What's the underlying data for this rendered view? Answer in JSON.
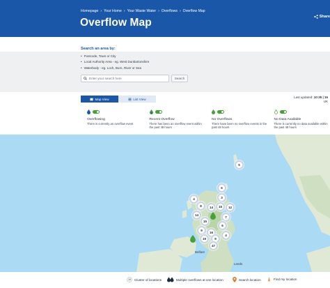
{
  "breadcrumbs": [
    "Homepage",
    "Your Home",
    "Your Waste Water",
    "Overflows",
    "Overflow Map"
  ],
  "page_title": "Overflow Map",
  "share_label": "Share",
  "search": {
    "heading": "Search an area by:",
    "hints": [
      "Postcode, Town or City",
      "Local Authority Area - eg. West Dunbartonshire",
      "Waterbody - eg. Loch, Burn, River or Sea"
    ],
    "placeholder": "Enter your search here",
    "button_label": "Search"
  },
  "tabs": [
    {
      "label": "Map View",
      "active": true,
      "icon": "map-icon"
    },
    {
      "label": "List View",
      "active": false,
      "icon": "list-icon"
    }
  ],
  "last_updated": {
    "label": "Last updated:",
    "value": "10:35 | 16",
    "suffix": "UK"
  },
  "legend": [
    {
      "title": "Overflowing",
      "desc": "There is currently an overflow event",
      "color": "#1a57a8",
      "icon": "droplet-icon"
    },
    {
      "title": "Recent Overflow",
      "desc": "There has been an overflow event within the past 48 hours",
      "color": "#48a03a",
      "icon": "droplet-icon"
    },
    {
      "title": "No Overflows",
      "desc": "There have been no overflow events in the past 48 hours",
      "color": "#48a03a",
      "icon": "droplet-icon"
    },
    {
      "title": "No Data Available",
      "desc": "There is currently no data available within the past 48 hours",
      "color": "#48a03a",
      "icon": "droplet-outline-icon"
    }
  ],
  "map": {
    "clusters": [
      "5",
      "6",
      "4",
      "3",
      "8",
      "14",
      "15",
      "12",
      "14",
      "7",
      "15",
      "6",
      "9",
      "16",
      "4",
      "19",
      "9",
      "47"
    ],
    "cities": [
      "Belfast",
      "Leeds"
    ]
  },
  "footer": {
    "cluster_label": "Cluster of locations",
    "cluster_sample": "15",
    "multiple_label": "Multiple overflows at one location",
    "search_loc_label": "Search location",
    "find_label": "Find my location"
  },
  "colors": {
    "brand": "#1a57a8",
    "green": "#48a03a",
    "orange": "#e8782a",
    "sea": "#aadaf4"
  }
}
